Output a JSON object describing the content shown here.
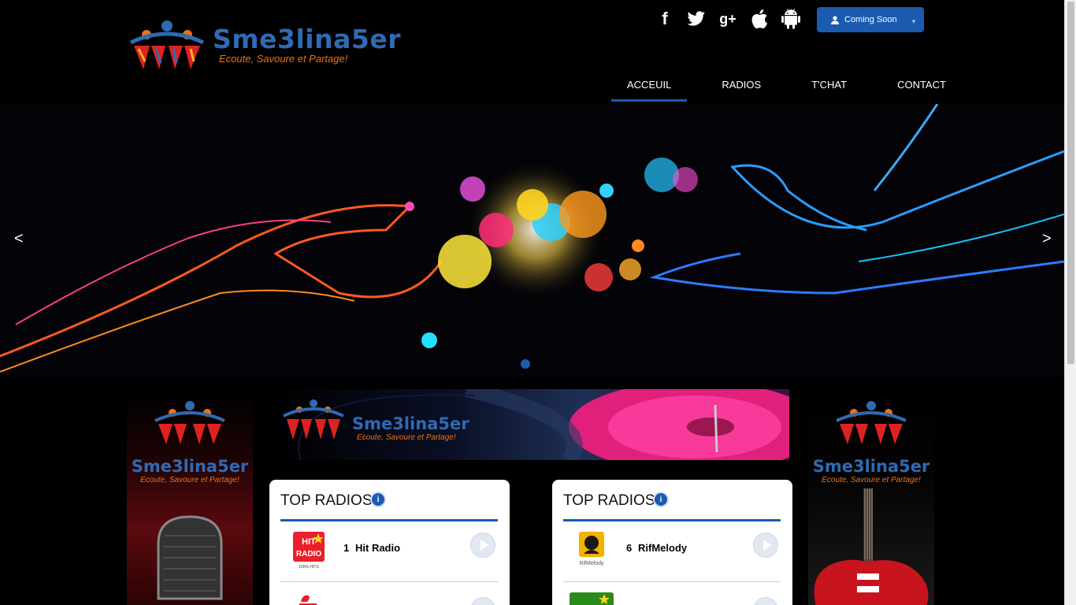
{
  "brand": {
    "name": "Sme3lina5er",
    "tagline": "Ecoute, Savoure et Partage!"
  },
  "header": {
    "social": [
      "facebook-icon",
      "twitter-icon",
      "google-plus-icon",
      "apple-icon",
      "android-icon"
    ],
    "coming_soon_label": "Coming Soon"
  },
  "nav": {
    "items": [
      {
        "label": "ACCEUIL",
        "active": true
      },
      {
        "label": "RADIOS",
        "active": false
      },
      {
        "label": "T'CHAT",
        "active": false
      },
      {
        "label": "CONTACT",
        "active": false
      }
    ]
  },
  "slider": {
    "prev": "<",
    "next": ">",
    "slides": 1,
    "current": 1
  },
  "cards": [
    {
      "title": "TOP RADIOS",
      "info_icon": "i",
      "items": [
        {
          "rank": "1",
          "name": "Hit Radio",
          "logo": "HIT RADIO"
        },
        {
          "rank": "",
          "name": "",
          "logo": ""
        }
      ]
    },
    {
      "title": "TOP RADIOS",
      "info_icon": "i",
      "items": [
        {
          "rank": "6",
          "name": "RifMelody",
          "logo": "RifMelody"
        },
        {
          "rank": "",
          "name": "",
          "logo": ""
        }
      ]
    }
  ],
  "colors": {
    "accent": "#1a5bb0",
    "brand_blue": "#2f6ab4",
    "brand_orange": "#e8731a"
  }
}
